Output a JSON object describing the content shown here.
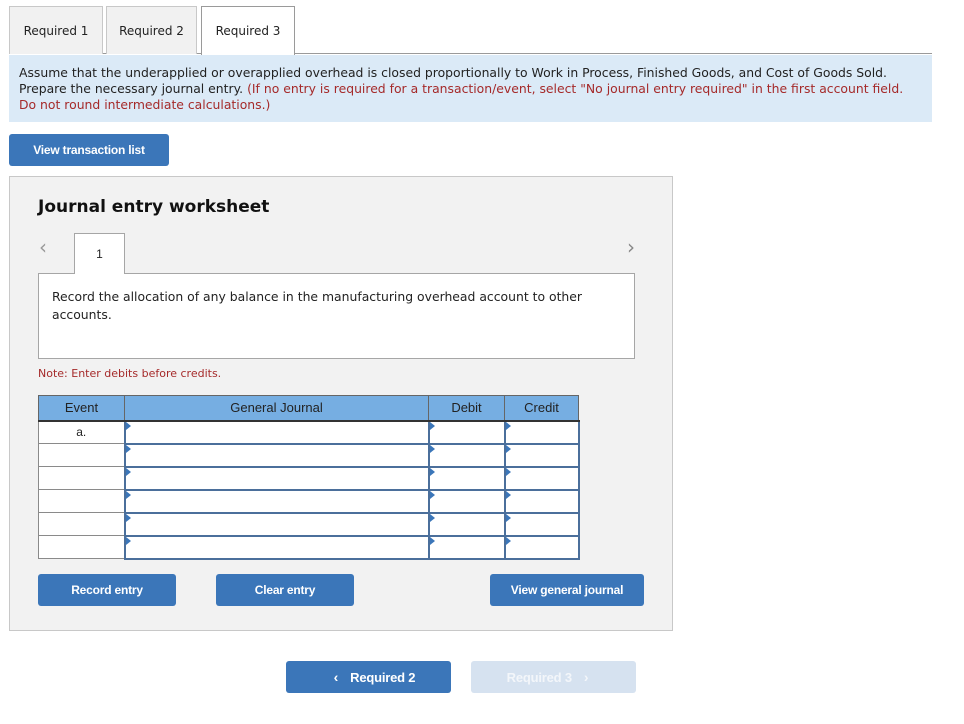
{
  "tabs": [
    {
      "label": "Required 1",
      "active": false
    },
    {
      "label": "Required 2",
      "active": false
    },
    {
      "label": "Required 3",
      "active": true
    }
  ],
  "instruction": {
    "text": "Assume that the underapplied or overapplied overhead is closed proportionally to Work in Process, Finished Goods, and Cost of Goods Sold. Prepare the necessary journal entry.",
    "hint": "(If no entry is required for a transaction/event, select \"No journal entry required\" in the first account field. Do not round intermediate calculations.)"
  },
  "buttons": {
    "view_transaction_list": "View transaction list",
    "record_entry": "Record entry",
    "clear_entry": "Clear entry",
    "view_general_journal": "View general journal"
  },
  "worksheet": {
    "title": "Journal entry worksheet",
    "prev_icon": "‹",
    "next_icon": "›",
    "entry_number": "1",
    "description": "Record the allocation of any balance in the manufacturing overhead account to other accounts.",
    "note": "Note: Enter debits before credits.",
    "columns": [
      "Event",
      "General Journal",
      "Debit",
      "Credit"
    ],
    "rows": [
      {
        "event": "a.",
        "account": "",
        "debit": "",
        "credit": ""
      },
      {
        "event": "",
        "account": "",
        "debit": "",
        "credit": ""
      },
      {
        "event": "",
        "account": "",
        "debit": "",
        "credit": ""
      },
      {
        "event": "",
        "account": "",
        "debit": "",
        "credit": ""
      },
      {
        "event": "",
        "account": "",
        "debit": "",
        "credit": ""
      },
      {
        "event": "",
        "account": "",
        "debit": "",
        "credit": ""
      }
    ]
  },
  "footer_nav": {
    "prev_label": "Required 2",
    "prev_icon": "‹",
    "next_label": "Required 3",
    "next_icon": "›",
    "next_disabled": true
  },
  "colors": {
    "primary": "#3b76b9",
    "instruction_bg": "#dbeaf7",
    "hint_red": "#a52a2a",
    "table_header": "#76aee2"
  }
}
